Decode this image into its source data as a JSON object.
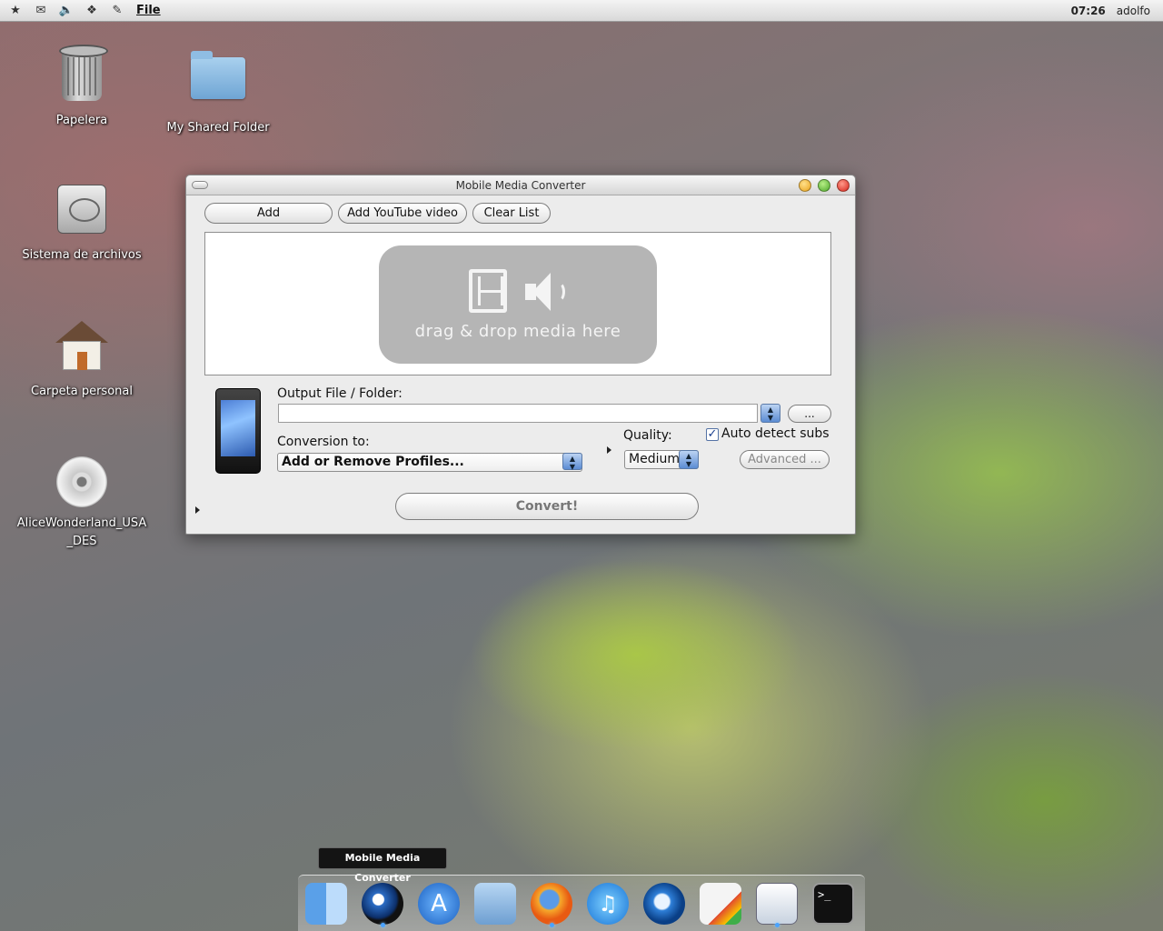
{
  "top_panel": {
    "menu_file": "File",
    "clock": "07:26",
    "user": "adolfo"
  },
  "desktop": {
    "icons": [
      {
        "label": "Papelera"
      },
      {
        "label": "My Shared Folder"
      },
      {
        "label": "Sistema de archivos"
      },
      {
        "label": "Carpeta personal"
      },
      {
        "label": "AliceWonderland_USA\n_DES"
      }
    ]
  },
  "window": {
    "title": "Mobile Media Converter",
    "toolbar": {
      "add": "Add",
      "add_youtube": "Add YouTube video",
      "clear_list": "Clear List"
    },
    "dropzone_text": "drag & drop media here",
    "output_label": "Output File / Folder:",
    "output_value": "",
    "browse_label": "...",
    "conversion_label": "Conversion to:",
    "conversion_value": "Add or Remove Profiles...",
    "quality_label": "Quality:",
    "quality_value": "Medium",
    "auto_detect_subs": "Auto detect subs",
    "auto_detect_checked": true,
    "advanced_label": "Advanced ...",
    "convert_label": "Convert!"
  },
  "dock": {
    "tooltip": "Mobile Media Converter",
    "items": [
      "finder-icon",
      "media-converter-icon",
      "app-store-icon",
      "user-folder-icon",
      "firefox-icon",
      "itunes-icon",
      "quicktime-icon",
      "system-monitor-icon",
      "text-editor-icon",
      "terminal-icon"
    ]
  },
  "colors": {
    "dock_running_dot": "#4aa3ff",
    "dropzone_bg": "#b5b5b5"
  }
}
